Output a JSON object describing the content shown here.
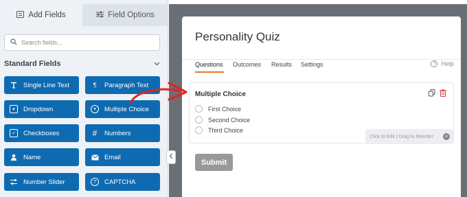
{
  "sidebar": {
    "tabs": [
      {
        "label": "Add Fields",
        "icon": "list-icon"
      },
      {
        "label": "Field Options",
        "icon": "sliders-icon"
      }
    ],
    "search_placeholder": "Search fields...",
    "section_title": "Standard Fields",
    "fields": [
      {
        "label": "Single Line Text",
        "icon": "text-icon"
      },
      {
        "label": "Paragraph Text",
        "icon": "paragraph-icon"
      },
      {
        "label": "Dropdown",
        "icon": "dropdown-icon"
      },
      {
        "label": "Multiple Choice",
        "icon": "radio-icon"
      },
      {
        "label": "Checkboxes",
        "icon": "checkbox-icon"
      },
      {
        "label": "Numbers",
        "icon": "hash-icon"
      },
      {
        "label": "Name",
        "icon": "user-icon"
      },
      {
        "label": "Email",
        "icon": "envelope-icon"
      },
      {
        "label": "Number Slider",
        "icon": "slider-icon"
      },
      {
        "label": "CAPTCHA",
        "icon": "question-circle-icon"
      }
    ]
  },
  "form": {
    "title": "Personality Quiz",
    "tabs": [
      "Questions",
      "Outcomes",
      "Results",
      "Settings"
    ],
    "active_tab": "Questions",
    "help_label": "Help",
    "field": {
      "label": "Multiple Choice",
      "choices": [
        "First Choice",
        "Second Choice",
        "Third Choice"
      ],
      "drag_hint": "Click to Edit | Drag to Reorder"
    },
    "submit_label": "Submit"
  },
  "colors": {
    "field_button": "#0e6bb1",
    "accent_tab": "#e27730",
    "arrow": "#e02424",
    "builder_bg": "#6a6f76",
    "delete_icon": "#d63638"
  }
}
